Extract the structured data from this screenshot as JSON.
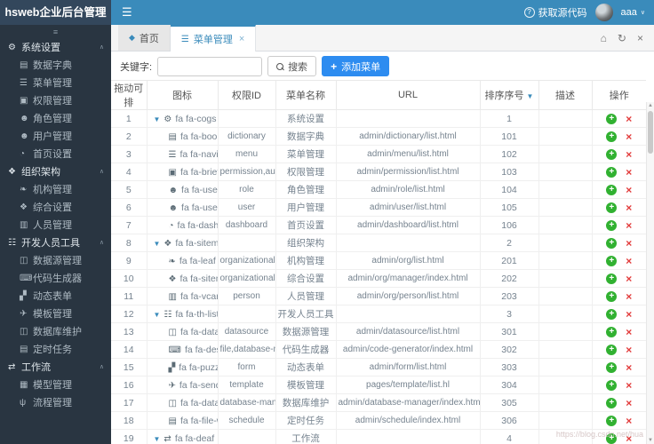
{
  "topbar": {
    "logo": "hsweb企业后台管理",
    "source_link": "获取源代码",
    "username": "aaa"
  },
  "tabs": {
    "home_label": "首页",
    "active_label": "菜单管理"
  },
  "sidebar": {
    "sections": [
      {
        "id": "system-settings",
        "label": "系统设置",
        "icon": "cogs",
        "glyph": "⚙",
        "items": [
          {
            "id": "data-dictionary",
            "label": "数据字典",
            "icon": "book",
            "glyph": "▤"
          },
          {
            "id": "menu-management",
            "label": "菜单管理",
            "icon": "navicon",
            "glyph": "☰"
          },
          {
            "id": "permission-management",
            "label": "权限管理",
            "icon": "briefcase",
            "glyph": "▣"
          },
          {
            "id": "role-management",
            "label": "角色管理",
            "icon": "users",
            "glyph": "☻"
          },
          {
            "id": "user-management",
            "label": "用户管理",
            "icon": "user",
            "glyph": "☻"
          },
          {
            "id": "home-settings",
            "label": "首页设置",
            "icon": "dashboard",
            "glyph": "◔"
          }
        ]
      },
      {
        "id": "organization",
        "label": "组织架构",
        "icon": "sitemap",
        "glyph": "❖",
        "items": [
          {
            "id": "org-management",
            "label": "机构管理",
            "icon": "leaf",
            "glyph": "❧"
          },
          {
            "id": "org-settings",
            "label": "综合设置",
            "icon": "sitemap",
            "glyph": "❖"
          },
          {
            "id": "personnel-management",
            "label": "人员管理",
            "icon": "vcard",
            "glyph": "▥"
          }
        ]
      },
      {
        "id": "developer-tools",
        "label": "开发人员工具",
        "icon": "th-list",
        "glyph": "☷",
        "items": [
          {
            "id": "datasource-management",
            "label": "数据源管理",
            "icon": "database",
            "glyph": "◫"
          },
          {
            "id": "code-generator",
            "label": "代码生成器",
            "icon": "desktop",
            "glyph": "⌨"
          },
          {
            "id": "dynamic-form",
            "label": "动态表单",
            "icon": "puzzle-piece",
            "glyph": "▞"
          },
          {
            "id": "template-management",
            "label": "模板管理",
            "icon": "send",
            "glyph": "✈"
          },
          {
            "id": "database-maintenance",
            "label": "数据库维护",
            "icon": "database",
            "glyph": "◫"
          },
          {
            "id": "scheduled-tasks",
            "label": "定时任务",
            "icon": "file",
            "glyph": "▤"
          }
        ]
      },
      {
        "id": "workflow",
        "label": "工作流",
        "icon": "workflow",
        "glyph": "⇄",
        "items": [
          {
            "id": "model-management",
            "label": "模型管理",
            "icon": "model",
            "glyph": "▦"
          },
          {
            "id": "process-management",
            "label": "流程管理",
            "icon": "code-fork",
            "glyph": "ψ"
          }
        ]
      }
    ]
  },
  "toolbar": {
    "keyword_label": "关键字:",
    "search_label": "搜索",
    "add_label": "添加菜单"
  },
  "table": {
    "columns": [
      "拖动可排",
      "图标",
      "权限ID",
      "菜单名称",
      "URL",
      "排序序号",
      "描述",
      "操作"
    ],
    "sorted_column_index": 5,
    "rows": [
      {
        "no": "1",
        "group": true,
        "icon": "cogs",
        "glyph": "⚙",
        "icon_text": "fa fa-cogs",
        "permission": "",
        "name": "系统设置",
        "url": "",
        "order": "1",
        "desc": ""
      },
      {
        "no": "2",
        "group": false,
        "icon": "book",
        "glyph": "▤",
        "icon_text": "fa fa-book",
        "permission": "dictionary",
        "name": "数据字典",
        "url": "admin/dictionary/list.html",
        "order": "101",
        "desc": ""
      },
      {
        "no": "3",
        "group": false,
        "icon": "navicon",
        "glyph": "☰",
        "icon_text": "fa fa-navic",
        "permission": "menu",
        "name": "菜单管理",
        "url": "admin/menu/list.html",
        "order": "102",
        "desc": ""
      },
      {
        "no": "4",
        "group": false,
        "icon": "briefcase",
        "glyph": "▣",
        "icon_text": "fa fa-briefc",
        "permission": "permission,autz-...",
        "name": "权限管理",
        "url": "admin/permission/list.html",
        "order": "103",
        "desc": ""
      },
      {
        "no": "5",
        "group": false,
        "icon": "users",
        "glyph": "☻",
        "icon_text": "fa fa-users",
        "permission": "role",
        "name": "角色管理",
        "url": "admin/role/list.html",
        "order": "104",
        "desc": ""
      },
      {
        "no": "6",
        "group": false,
        "icon": "user",
        "glyph": "☻",
        "icon_text": "fa fa-user",
        "permission": "user",
        "name": "用户管理",
        "url": "admin/user/list.html",
        "order": "105",
        "desc": ""
      },
      {
        "no": "7",
        "group": false,
        "icon": "dashboard",
        "glyph": "◔",
        "icon_text": "fa fa-dash",
        "permission": "dashboard",
        "name": "首页设置",
        "url": "admin/dashboard/list.html",
        "order": "106",
        "desc": ""
      },
      {
        "no": "8",
        "group": true,
        "icon": "sitemap",
        "glyph": "❖",
        "icon_text": "fa fa-sitemap",
        "permission": "",
        "name": "组织架构",
        "url": "",
        "order": "2",
        "desc": ""
      },
      {
        "no": "9",
        "group": false,
        "icon": "leaf",
        "glyph": "❧",
        "icon_text": "fa fa-leaf",
        "permission": "organizational",
        "name": "机构管理",
        "url": "admin/org/list.html",
        "order": "201",
        "desc": ""
      },
      {
        "no": "10",
        "group": false,
        "icon": "sitemap",
        "glyph": "❖",
        "icon_text": "fa fa-sitem",
        "permission": "organizational,de...",
        "name": "综合设置",
        "url": "admin/org/manager/index.html",
        "order": "202",
        "desc": ""
      },
      {
        "no": "11",
        "group": false,
        "icon": "vcard",
        "glyph": "▥",
        "icon_text": "fa fa-vcard",
        "permission": "person",
        "name": "人员管理",
        "url": "admin/org/person/list.html",
        "order": "203",
        "desc": ""
      },
      {
        "no": "12",
        "group": true,
        "icon": "th-list",
        "glyph": "☷",
        "icon_text": "fa fa-th-list",
        "permission": "",
        "name": "开发人员工具",
        "url": "",
        "order": "3",
        "desc": ""
      },
      {
        "no": "13",
        "group": false,
        "icon": "database",
        "glyph": "◫",
        "icon_text": "fa fa-datab",
        "permission": "datasource",
        "name": "数据源管理",
        "url": "admin/datasource/list.html",
        "order": "301",
        "desc": ""
      },
      {
        "no": "14",
        "group": false,
        "icon": "desktop",
        "glyph": "⌨",
        "icon_text": "fa fa-deskt",
        "permission": "file,database-ma...",
        "name": "代码生成器",
        "url": "admin/code-generator/index.html",
        "order": "302",
        "desc": ""
      },
      {
        "no": "15",
        "group": false,
        "icon": "puzzle-piece",
        "glyph": "▞",
        "icon_text": "fa fa-puzzl",
        "permission": "form",
        "name": "动态表单",
        "url": "admin/form/list.html",
        "order": "303",
        "desc": ""
      },
      {
        "no": "16",
        "group": false,
        "icon": "send",
        "glyph": "✈",
        "icon_text": "fa fa-send",
        "permission": "template",
        "name": "模板管理",
        "url": "pages/template/list.hl",
        "order": "304",
        "desc": ""
      },
      {
        "no": "17",
        "group": false,
        "icon": "database",
        "glyph": "◫",
        "icon_text": "fa fa-datab",
        "permission": "database-manag...",
        "name": "数据库维护",
        "url": "admin/database-manager/index.html",
        "order": "305",
        "desc": ""
      },
      {
        "no": "18",
        "group": false,
        "icon": "file",
        "glyph": "▤",
        "icon_text": "fa fa-file-w",
        "permission": "schedule",
        "name": "定时任务",
        "url": "admin/schedule/index.html",
        "order": "306",
        "desc": ""
      },
      {
        "no": "19",
        "group": true,
        "icon": "workflow",
        "glyph": "⇄",
        "icon_text": "fa fa-deaf",
        "permission": "",
        "name": "工作流",
        "url": "",
        "order": "4",
        "desc": ""
      }
    ]
  },
  "watermark": "https://blog.csdn.net/hua",
  "colors": {
    "accent": "#3a8bbb",
    "logo_bg": "#33475c",
    "sidebar_bg": "#293541",
    "add_button": "#2d8cf0",
    "success": "#31b131",
    "danger": "#e23b3b"
  }
}
